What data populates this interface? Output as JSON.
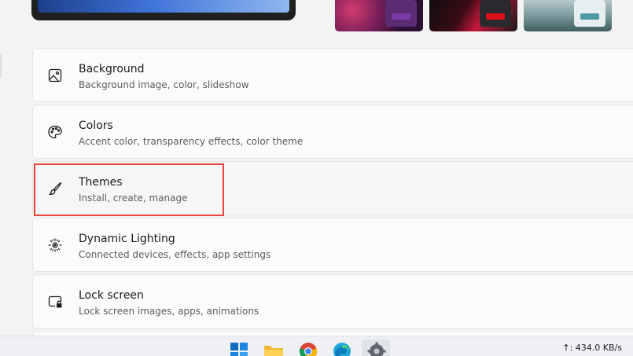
{
  "settings_items": [
    {
      "title": "Background",
      "subtitle": "Background image, color, slideshow",
      "icon": "image-icon"
    },
    {
      "title": "Colors",
      "subtitle": "Accent color, transparency effects, color theme",
      "icon": "palette-icon"
    },
    {
      "title": "Themes",
      "subtitle": "Install, create, manage",
      "icon": "brush-icon"
    },
    {
      "title": "Dynamic Lighting",
      "subtitle": "Connected devices, effects, app settings",
      "icon": "dynamic-lighting-icon"
    },
    {
      "title": "Lock screen",
      "subtitle": "Lock screen images, apps, animations",
      "icon": "lock-screen-icon"
    }
  ],
  "colors": {
    "highlight": "#e8453c",
    "accent": "#0067c0"
  },
  "taskbar": {
    "icons": [
      "windows-start-icon",
      "file-explorer-icon",
      "chrome-icon",
      "edge-icon",
      "settings-icon"
    ],
    "network_speed": "↑: 434.0 KB/s"
  }
}
